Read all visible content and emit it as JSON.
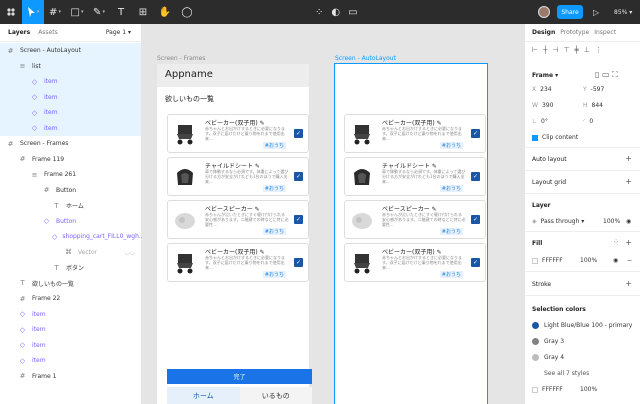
{
  "toolbar": {
    "share_label": "Share",
    "zoom_label": "85%",
    "play_icon": "play-icon"
  },
  "layers_panel": {
    "tabs": [
      "Layers",
      "Assets"
    ],
    "page_selector": "Page 1",
    "items": [
      {
        "label": "Screen - AutoLayout"
      },
      {
        "label": "list"
      },
      {
        "label": "item"
      },
      {
        "label": "item"
      },
      {
        "label": "item"
      },
      {
        "label": "item"
      },
      {
        "label": "Screen - Frames"
      },
      {
        "label": "Frame 119"
      },
      {
        "label": "Frame 261"
      },
      {
        "label": "Button"
      },
      {
        "label": "ホーム"
      },
      {
        "label": "Button"
      },
      {
        "label": "shopping_cart_FILL0_wgh..."
      },
      {
        "label": "Vector"
      },
      {
        "label": "ボタン"
      },
      {
        "label": "欲しいもの一覧"
      },
      {
        "label": "Frame 22"
      },
      {
        "label": "item"
      },
      {
        "label": "item"
      },
      {
        "label": "item"
      },
      {
        "label": "item"
      },
      {
        "label": "Frame 1"
      }
    ]
  },
  "canvas": {
    "frame_a_label": "Screen - Frames",
    "frame_b_label": "Screen - AutoLayout",
    "app_title": "Appname",
    "list_title": "欲しいもの一覧",
    "items": [
      {
        "title": "ベビーカー(双子用)",
        "desc": "赤ちゃんとお出かけするときに必要になります。双子に届けだけど乗り物をれまで使用出来...",
        "tag": "#おうち",
        "thumb": "stroller"
      },
      {
        "title": "チャイルドシート",
        "desc": "車で移動するなら必須です。体重によって選び分ける方が安全がけれども1台のほうで購入出来...",
        "tag": "#おうち",
        "thumb": "car-seat"
      },
      {
        "title": "ベビースピーカー",
        "desc": "赤ちゃんが泣いたときにすぐ駆け付けられる安心感があります。二階建ての時などに特に必要性...",
        "tag": "#おうち",
        "thumb": "speaker"
      },
      {
        "title": "ベビーカー(双子用)",
        "desc": "赤ちゃんとお出かけするときに必要になります。双子に届けだけど乗り物をれまで使用出来...",
        "tag": "#おうち",
        "thumb": "stroller"
      }
    ],
    "complete_button": "完了",
    "tab_home": "ホーム",
    "tab_want": "いるもの"
  },
  "design_panel": {
    "tabs": [
      "Design",
      "Prototype",
      "Inspect"
    ],
    "frame_label": "Frame",
    "x": "234",
    "y": "-597",
    "w": "390",
    "h": "844",
    "rotation": "0°",
    "radius": "0",
    "clip_label": "Clip content",
    "auto_layout_label": "Auto layout",
    "layout_grid_label": "Layout grid",
    "layer_label": "Layer",
    "pass_through": "Pass through",
    "layer_opacity": "100%",
    "fill_label": "Fill",
    "fill_hex": "FFFFFF",
    "fill_opacity": "100%",
    "stroke_label": "Stroke",
    "selection_colors_label": "Selection colors",
    "colors": [
      {
        "name": "Light Blue/Blue 100 - primary",
        "hex": "#1a56a6"
      },
      {
        "name": "Gray 3",
        "hex": "#828282"
      },
      {
        "name": "Gray 4",
        "hex": "#bdbdbd"
      }
    ],
    "see_all": "See all 7 styles",
    "sel_hex": "FFFFFF",
    "sel_opacity": "100%"
  },
  "colors": {
    "accent": "#0d99ff",
    "primary": "#1a74e8",
    "toolbar_bg": "#2c2c2c"
  }
}
